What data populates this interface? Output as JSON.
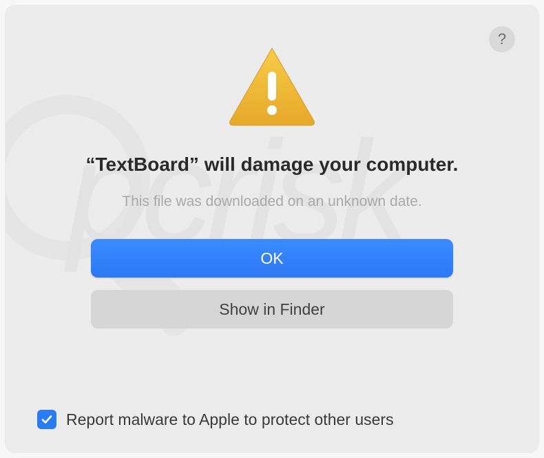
{
  "dialog": {
    "help_label": "?",
    "title_prefix": "“",
    "title_app": "TextBoard",
    "title_suffix": "” will damage your computer.",
    "subtitle": "This file was downloaded on an unknown date.",
    "primary_button": "OK",
    "secondary_button": "Show in Finder",
    "checkbox_label": "Report malware to Apple to protect other users",
    "checkbox_checked": true
  }
}
